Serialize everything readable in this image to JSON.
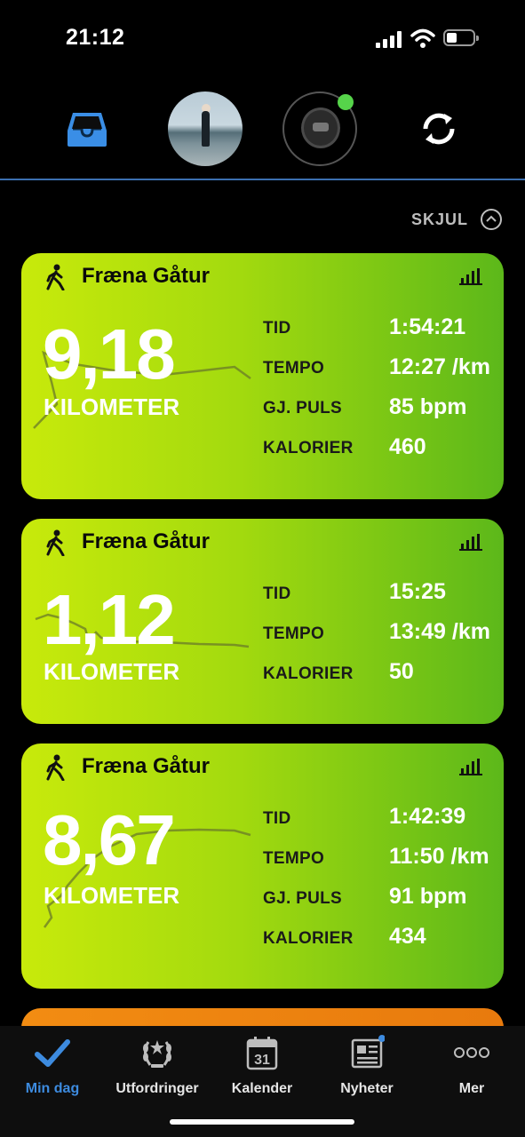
{
  "status_bar": {
    "time": "21:12",
    "battery_level": 0.3
  },
  "toolbar": {
    "icons": [
      "inbox-icon",
      "profile-avatar",
      "watch-device-icon",
      "sync-icon"
    ],
    "device_connected": true
  },
  "summary": {
    "hide_label": "SKJUL"
  },
  "activities": [
    {
      "title": "Fræna Gåtur",
      "distance": "9,18",
      "unit": "KILOMETER",
      "stats": [
        {
          "label": "TID",
          "value": "1:54:21"
        },
        {
          "label": "TEMPO",
          "value": "12:27 /km"
        },
        {
          "label": "GJ. PULS",
          "value": "85 bpm"
        },
        {
          "label": "KALORIER",
          "value": "460"
        }
      ]
    },
    {
      "title": "Fræna Gåtur",
      "distance": "1,12",
      "unit": "KILOMETER",
      "stats": [
        {
          "label": "TID",
          "value": "15:25"
        },
        {
          "label": "TEMPO",
          "value": "13:49 /km"
        },
        {
          "label": "KALORIER",
          "value": "50"
        }
      ]
    },
    {
      "title": "Fræna Gåtur",
      "distance": "8,67",
      "unit": "KILOMETER",
      "stats": [
        {
          "label": "TID",
          "value": "1:42:39"
        },
        {
          "label": "TEMPO",
          "value": "11:50 /km"
        },
        {
          "label": "GJ. PULS",
          "value": "91 bpm"
        },
        {
          "label": "KALORIER",
          "value": "434"
        }
      ]
    }
  ],
  "bottom_nav": [
    {
      "label": "Min dag",
      "icon": "checkmark-icon",
      "active": true
    },
    {
      "label": "Utfordringer",
      "icon": "laurel-icon",
      "active": false
    },
    {
      "label": "Kalender",
      "icon": "calendar-icon",
      "active": false,
      "calendar_day": "31"
    },
    {
      "label": "Nyheter",
      "icon": "news-icon",
      "active": false,
      "has_badge": true
    },
    {
      "label": "Mer",
      "icon": "more-icon",
      "active": false
    }
  ],
  "colors": {
    "accent": "#3d8bdf",
    "card_green_start": "#c8ea0b",
    "card_green_end": "#5cb81a",
    "card_orange": "#f28c12",
    "status_dot": "#56d44a"
  }
}
